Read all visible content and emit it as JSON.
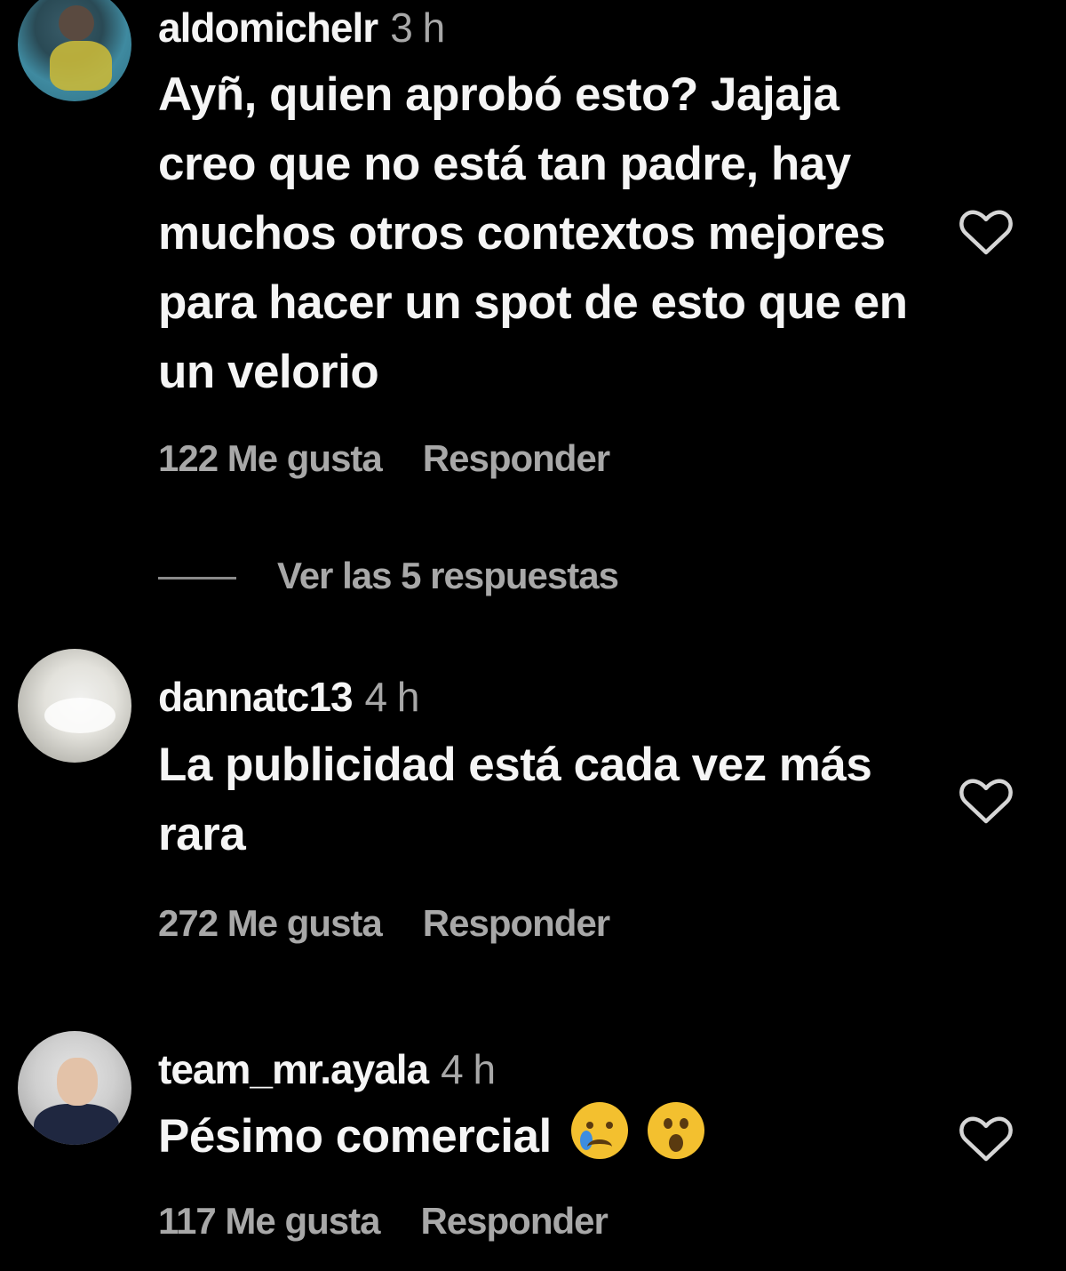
{
  "comments": [
    {
      "username": "aldomichelr",
      "time": "3 h",
      "text": "Ayñ, quien aprobó esto? Jajaja creo que no está tan padre, hay muchos otros contextos mejores para hacer un spot de esto que en un velorio",
      "likes": "122 Me gusta",
      "reply": "Responder"
    },
    {
      "username": "dannatc13",
      "time": "4 h",
      "text": "La publicidad está cada vez más rara",
      "likes": "272 Me gusta",
      "reply": "Responder"
    },
    {
      "username": "team_mr.ayala",
      "time": "4 h",
      "text": "Pésimo comercial",
      "likes": "117 Me gusta",
      "reply": "Responder",
      "emojis": [
        "crying-face",
        "astonished-face"
      ]
    }
  ],
  "view_replies": "Ver las 5 respuestas",
  "icons": {
    "like": "heart-outline-icon"
  },
  "colors": {
    "background": "#000000",
    "primary_text": "#f5f5f5",
    "secondary_text": "#a8a8a8"
  }
}
